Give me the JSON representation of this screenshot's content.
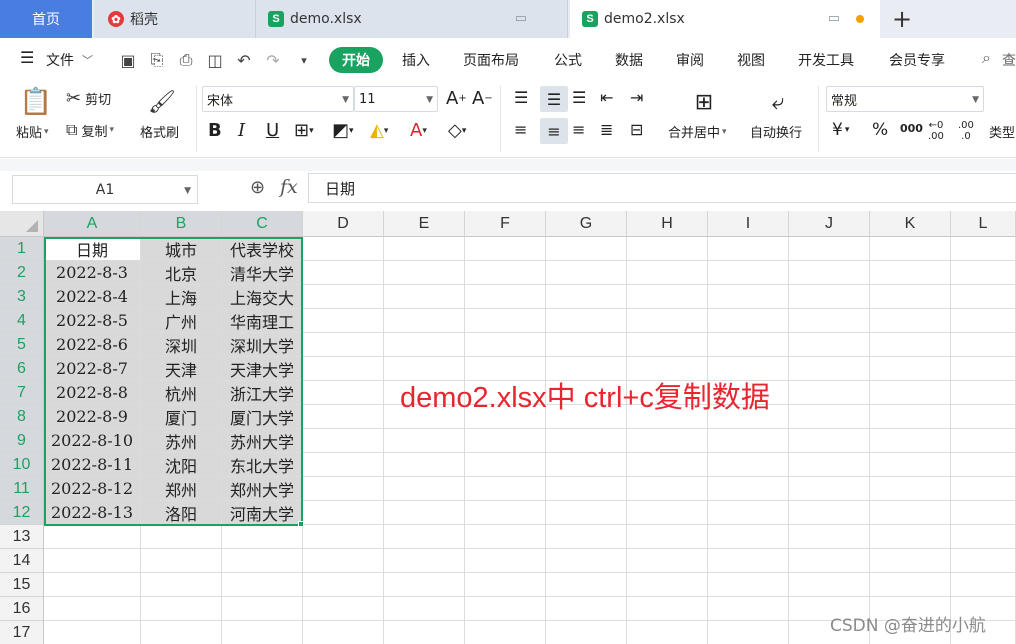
{
  "tabs": {
    "home": "首页",
    "daoke": "稻壳",
    "file1": "demo.xlsx",
    "file2": "demo2.xlsx",
    "new_tab": "+"
  },
  "menu": {
    "file": "文件",
    "items": [
      "开始",
      "插入",
      "页面布局",
      "公式",
      "数据",
      "审阅",
      "视图",
      "开发工具",
      "会员专享",
      "查"
    ]
  },
  "ribbon": {
    "paste": "粘贴",
    "cut": "剪切",
    "copy": "复制",
    "format_painter": "格式刷",
    "font_name": "宋体",
    "font_size": "11",
    "merge_center": "合并居中",
    "wrap_text": "自动换行",
    "number_format": "常规",
    "type_label": "类型",
    "percent": "%",
    "thousands": "000",
    "increase_decimal": ".00",
    "decrease_decimal": ".0",
    "currency": "¥"
  },
  "formula_bar": {
    "name_box": "A1",
    "fx": "fx",
    "content": "日期"
  },
  "sheet": {
    "columns": [
      "A",
      "B",
      "C",
      "D",
      "E",
      "F",
      "G",
      "H",
      "I",
      "J",
      "K",
      "L"
    ],
    "rows": [
      "1",
      "2",
      "3",
      "4",
      "5",
      "6",
      "7",
      "8",
      "9",
      "10",
      "11",
      "12",
      "13",
      "14",
      "15",
      "16",
      "17"
    ],
    "data": [
      [
        "日期",
        "城市",
        "代表学校"
      ],
      [
        "2022-8-3",
        "北京",
        "清华大学"
      ],
      [
        "2022-8-4",
        "上海",
        "上海交大"
      ],
      [
        "2022-8-5",
        "广州",
        "华南理工"
      ],
      [
        "2022-8-6",
        "深圳",
        "深圳大学"
      ],
      [
        "2022-8-7",
        "天津",
        "天津大学"
      ],
      [
        "2022-8-8",
        "杭州",
        "浙江大学"
      ],
      [
        "2022-8-9",
        "厦门",
        "厦门大学"
      ],
      [
        "2022-8-10",
        "苏州",
        "苏州大学"
      ],
      [
        "2022-8-11",
        "沈阳",
        "东北大学"
      ],
      [
        "2022-8-12",
        "郑州",
        "郑州大学"
      ],
      [
        "2022-8-13",
        "洛阳",
        "河南大学"
      ]
    ]
  },
  "annotation": "demo2.xlsx中 ctrl+c复制数据",
  "watermark": "CSDN @奋进的小航",
  "colors": {
    "accent": "#1aa260",
    "home_tab": "#4a7de2",
    "annotation": "#e8262f",
    "unsaved_dot": "#f3a200"
  }
}
